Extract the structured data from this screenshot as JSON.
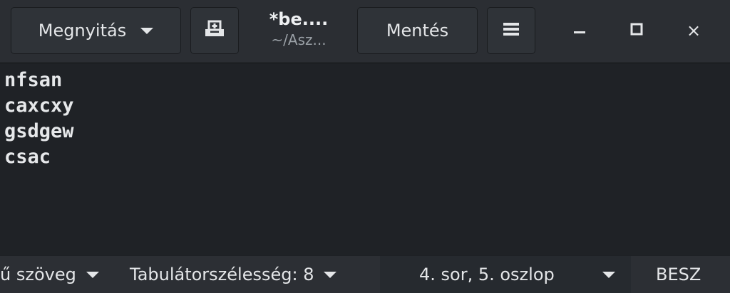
{
  "header": {
    "open_label": "Megnyitás",
    "new_doc_icon": "new-document-icon",
    "title": "*be....",
    "subtitle": "~/Asz...",
    "save_label": "Mentés",
    "menu_icon": "hamburger-menu-icon"
  },
  "window_controls": {
    "minimize": "minimize-icon",
    "maximize": "maximize-icon",
    "close": "×"
  },
  "editor": {
    "lines": [
      "nfsan",
      "caxcxy",
      "gsdgew",
      "csac"
    ]
  },
  "statusbar": {
    "language": "ű szöveg",
    "tab_width": "Tabulátorszélesség: 8",
    "position": "4. sor, 5. oszlop",
    "insert_mode": "BESZ"
  },
  "colors": {
    "background": "#1e2125",
    "headerbar": "#2b2e33",
    "text": "#e4e6e8"
  }
}
